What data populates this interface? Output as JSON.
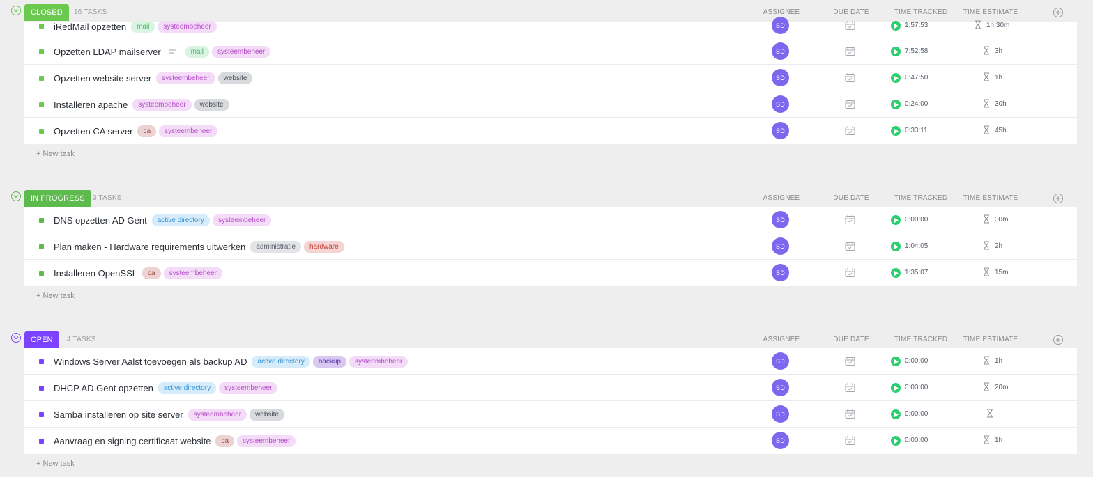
{
  "columns": {
    "assignee": "ASSIGNEE",
    "due_date": "DUE DATE",
    "time_tracked": "TIME TRACKED",
    "time_estimate": "TIME ESTIMATE"
  },
  "new_task_label": "+ New task",
  "colors": {
    "closed": "#6bc950",
    "in_progress": "#5dba4c",
    "open": "#7b42ff",
    "avatar": "#7b68ee",
    "play": "#2ecd6f"
  },
  "groups": [
    {
      "status": "CLOSED",
      "count_label": "16 TASKS",
      "tasks": [
        {
          "name": "iRedMail opzetten",
          "description": false,
          "tags": [
            "mail",
            "systeembeheer"
          ],
          "assignee": "SD",
          "tracked": "1:57:53",
          "estimate": "1h 30m"
        },
        {
          "name": "Opzetten LDAP mailserver",
          "description": true,
          "tags": [
            "mail",
            "systeembeheer"
          ],
          "assignee": "SD",
          "tracked": "7:52:58",
          "estimate": "3h"
        },
        {
          "name": "Opzetten website server",
          "description": false,
          "tags": [
            "systeembeheer",
            "website"
          ],
          "assignee": "SD",
          "tracked": "0:47:50",
          "estimate": "1h"
        },
        {
          "name": "Installeren apache",
          "description": false,
          "tags": [
            "systeembeheer",
            "website"
          ],
          "assignee": "SD",
          "tracked": "0:24:00",
          "estimate": "30h"
        },
        {
          "name": "Opzetten CA server",
          "description": false,
          "tags": [
            "ca",
            "systeembeheer"
          ],
          "assignee": "SD",
          "tracked": "0:33:11",
          "estimate": "45h"
        }
      ]
    },
    {
      "status": "IN PROGRESS",
      "count_label": "3 TASKS",
      "tasks": [
        {
          "name": "DNS opzetten AD Gent",
          "description": false,
          "tags": [
            "active directory",
            "systeembeheer"
          ],
          "assignee": "SD",
          "tracked": "0:00:00",
          "estimate": "30m"
        },
        {
          "name": "Plan maken - Hardware requirements uitwerken",
          "description": false,
          "tags": [
            "administratie",
            "hardware"
          ],
          "assignee": "SD",
          "tracked": "1:04:05",
          "estimate": "2h"
        },
        {
          "name": "Installeren OpenSSL",
          "description": false,
          "tags": [
            "ca",
            "systeembeheer"
          ],
          "assignee": "SD",
          "tracked": "1:35:07",
          "estimate": "15m"
        }
      ]
    },
    {
      "status": "OPEN",
      "count_label": "4 TASKS",
      "tasks": [
        {
          "name": "Windows Server Aalst toevoegen als backup AD",
          "description": false,
          "tags": [
            "active directory",
            "backup",
            "systeembeheer"
          ],
          "assignee": "SD",
          "tracked": "0:00:00",
          "estimate": "1h"
        },
        {
          "name": "DHCP AD Gent opzetten",
          "description": false,
          "tags": [
            "active directory",
            "systeembeheer"
          ],
          "assignee": "SD",
          "tracked": "0:00:00",
          "estimate": "20m"
        },
        {
          "name": "Samba installeren op site server",
          "description": false,
          "tags": [
            "systeembeheer",
            "website"
          ],
          "assignee": "SD",
          "tracked": "0:00:00",
          "estimate": ""
        },
        {
          "name": "Aanvraag en signing certificaat website",
          "description": false,
          "tags": [
            "ca",
            "systeembeheer"
          ],
          "assignee": "SD",
          "tracked": "0:00:00",
          "estimate": "1h"
        }
      ]
    }
  ],
  "tag_styles": {
    "mail": {
      "bg": "#d9f5e1",
      "fg": "#4cb36b"
    },
    "systeembeheer": {
      "bg": "#f4dcf9",
      "fg": "#b24cc4"
    },
    "website": {
      "bg": "#d8dadd",
      "fg": "#4a4f57"
    },
    "ca": {
      "bg": "#ecd3d3",
      "fg": "#a6473f"
    },
    "active directory": {
      "bg": "#d6ecfa",
      "fg": "#3593d6"
    },
    "administratie": {
      "bg": "#e2e4e7",
      "fg": "#5e636b"
    },
    "hardware": {
      "bg": "#f5d4d4",
      "fg": "#c2453b"
    },
    "backup": {
      "bg": "#d9c9f2",
      "fg": "#5d36a8"
    }
  }
}
